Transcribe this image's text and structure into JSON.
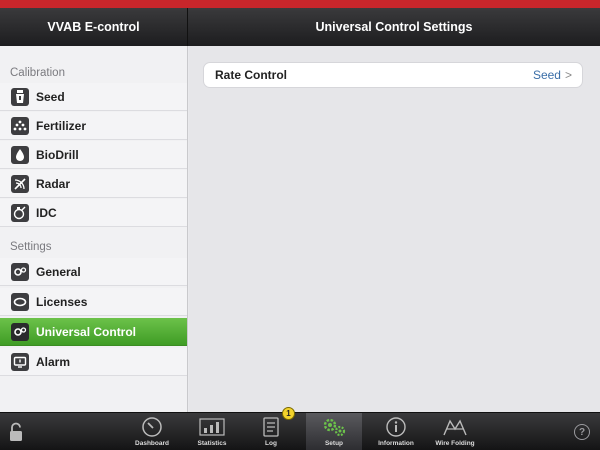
{
  "header": {
    "left_title": "VVAB E-control",
    "right_title": "Universal Control Settings"
  },
  "sidebar": {
    "calibration_label": "Calibration",
    "settings_label": "Settings",
    "items": [
      {
        "label": "Seed",
        "icon": "seed-icon"
      },
      {
        "label": "Fertilizer",
        "icon": "fertilizer-icon"
      },
      {
        "label": "BioDrill",
        "icon": "biodrill-icon"
      },
      {
        "label": "Radar",
        "icon": "radar-icon"
      },
      {
        "label": "IDC",
        "icon": "idc-icon"
      },
      {
        "label": "General",
        "icon": "general-icon"
      },
      {
        "label": "Licenses",
        "icon": "licenses-icon"
      },
      {
        "label": "Universal Control",
        "icon": "universal-control-icon",
        "active": true
      },
      {
        "label": "Alarm",
        "icon": "alarm-icon"
      }
    ]
  },
  "main": {
    "rows": [
      {
        "title": "Rate Control",
        "value": "Seed"
      }
    ]
  },
  "bottombar": {
    "items": [
      {
        "label": "Dashboard",
        "icon": "gauge-icon"
      },
      {
        "label": "Statistics",
        "icon": "statistics-icon"
      },
      {
        "label": "Log",
        "icon": "log-icon",
        "badge": "1"
      },
      {
        "label": "Setup",
        "icon": "gears-icon",
        "active": true
      },
      {
        "label": "Information",
        "icon": "info-icon"
      },
      {
        "label": "Wire Folding",
        "icon": "wire-folding-icon"
      }
    ],
    "help_glyph": "?"
  },
  "colors": {
    "accent_red": "#c8262b",
    "active_green": "#4fae32",
    "link_blue": "#3a6ea8",
    "badge_yellow": "#f3d32b"
  }
}
